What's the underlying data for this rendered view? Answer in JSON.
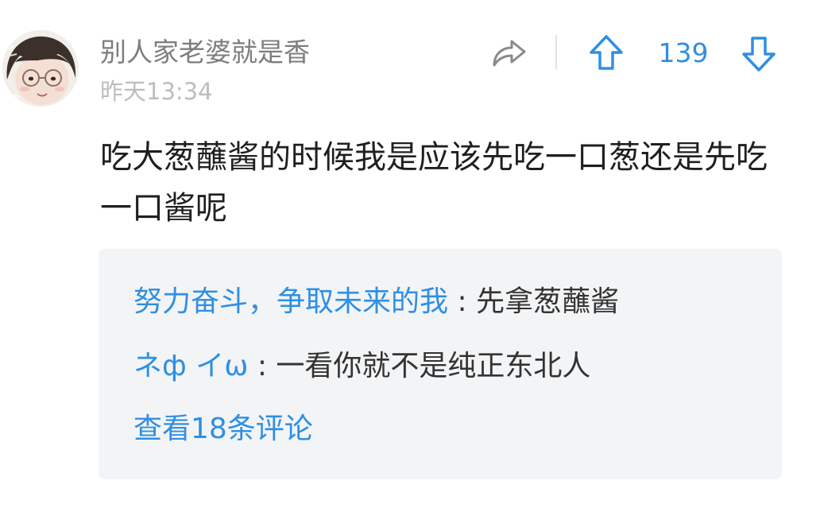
{
  "post": {
    "username": "别人家老婆就是香",
    "timestamp": "昨天13:34",
    "content": "吃大葱蘸酱的时候我是应该先吃一口葱还是先吃一口酱呢",
    "votes": "139",
    "avatar_icon": "user-avatar-photo",
    "share_icon": "share-arrow-icon",
    "upvote_icon": "upvote-arrow-icon",
    "downvote_icon": "downvote-arrow-icon"
  },
  "replies": [
    {
      "author": "努力奋斗，争取未来的我",
      "separator": ":",
      "text": "先拿葱蘸酱"
    },
    {
      "author": "ネф イω",
      "separator": ":",
      "text": "一看你就不是纯正东北人"
    }
  ],
  "view_more": "查看18条评论",
  "colors": {
    "accent": "#2f8fe3",
    "username": "#7d7d7d",
    "timestamp": "#bdbdbd",
    "body_text": "#1f1f1f",
    "reply_bg": "#f3f4f6"
  }
}
